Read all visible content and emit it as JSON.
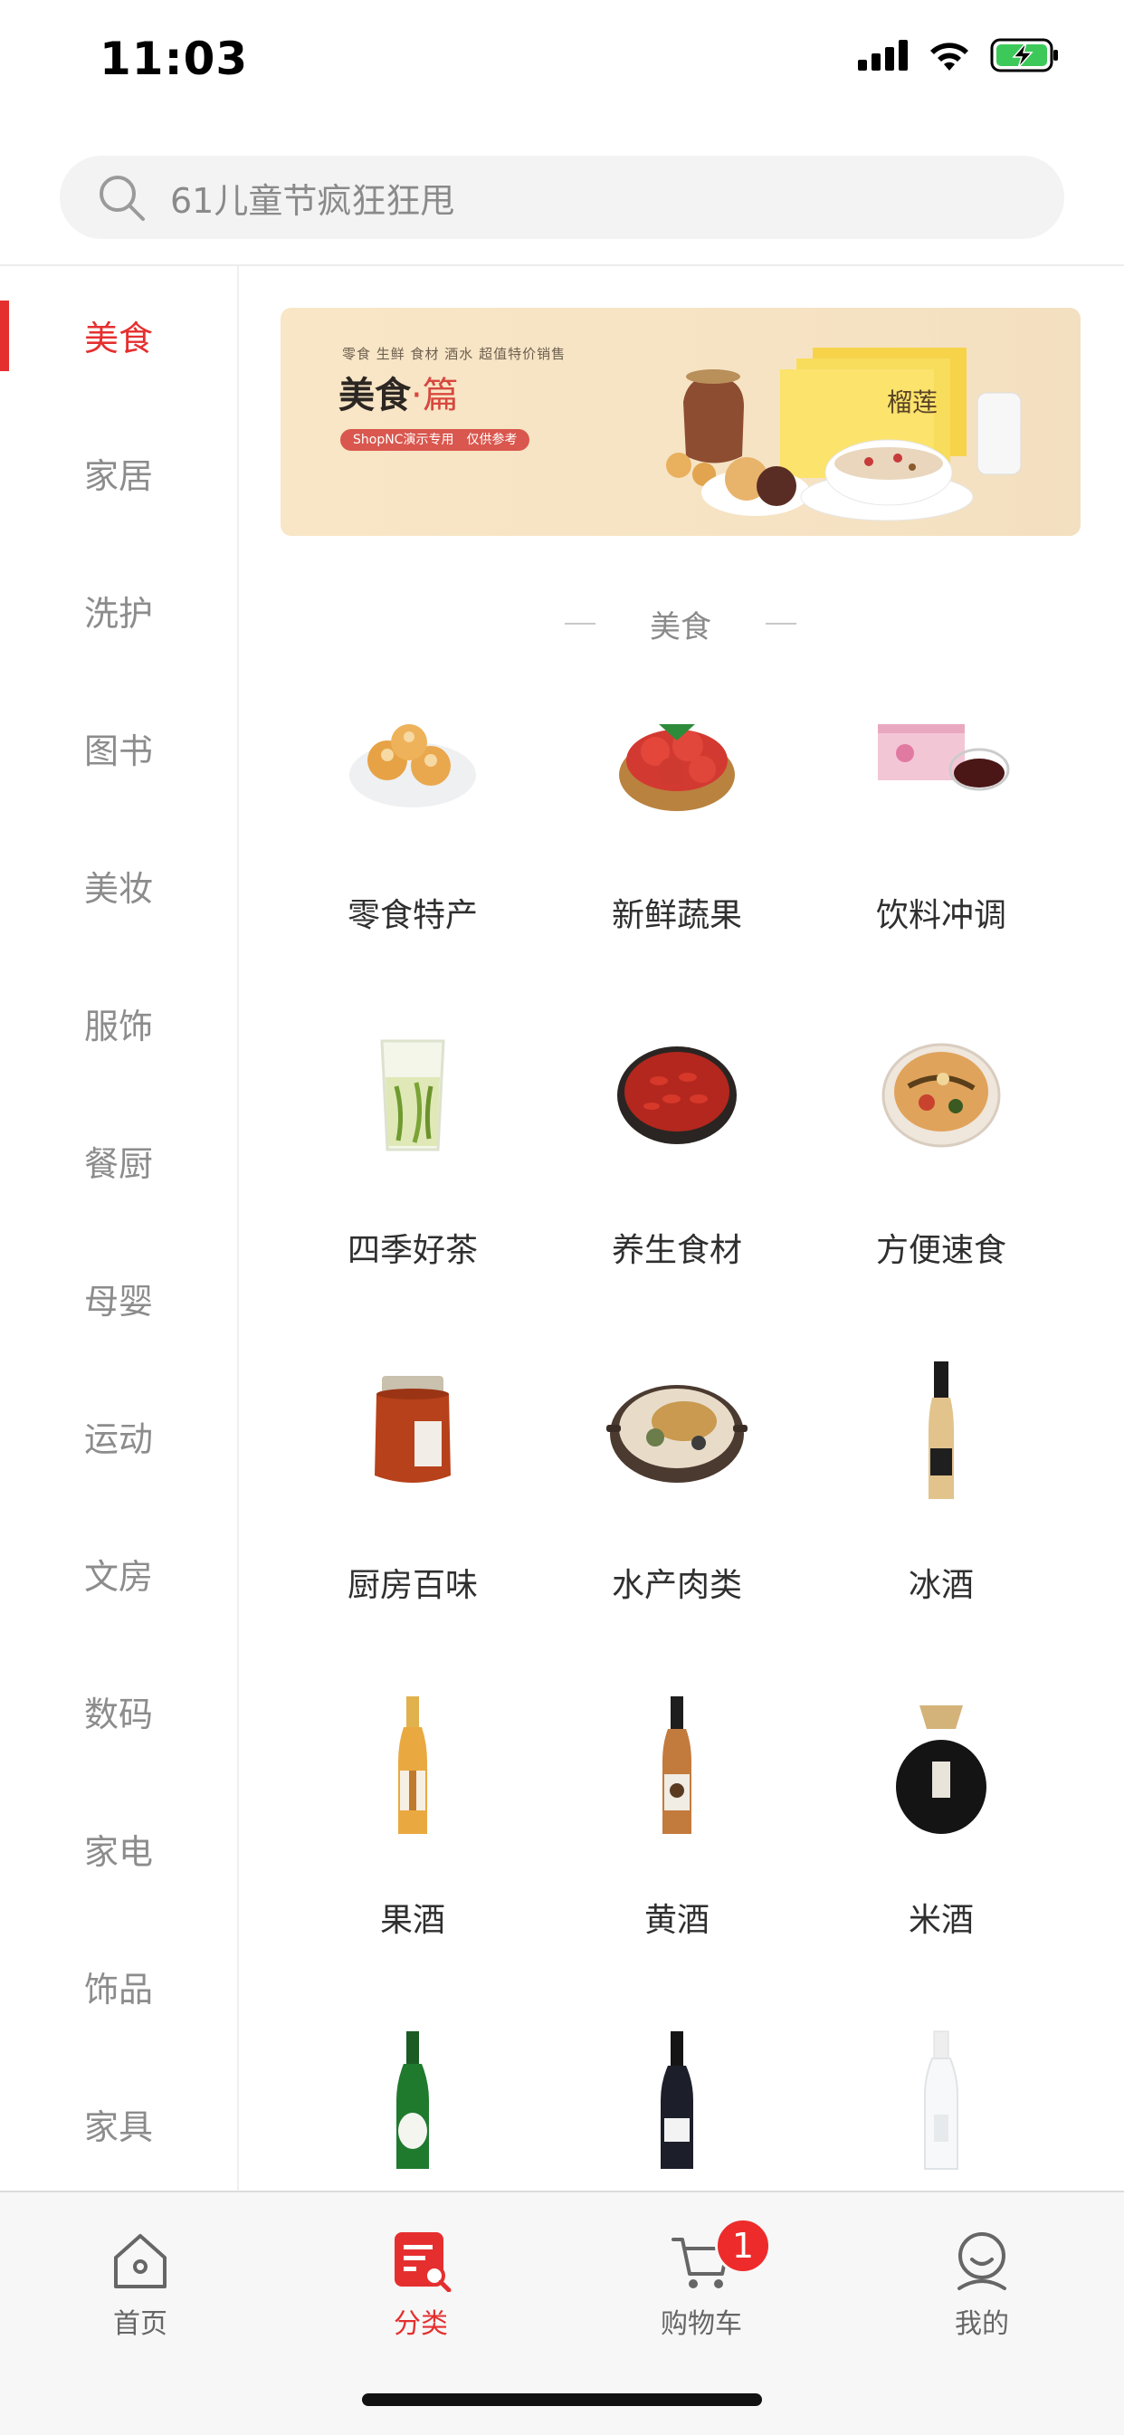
{
  "status_bar": {
    "time": "11:03"
  },
  "search": {
    "placeholder": "61儿童节疯狂狂甩"
  },
  "sidebar": {
    "active_index": 0,
    "items": [
      "美食",
      "家居",
      "洗护",
      "图书",
      "美妆",
      "服饰",
      "餐厨",
      "母婴",
      "运动",
      "文房",
      "数码",
      "家电",
      "饰品",
      "家具"
    ]
  },
  "banner": {
    "subtitle": "零食 生鲜 食材 酒水 超值特价销售",
    "title_main": "美食",
    "title_accent": "·篇",
    "tag": "ShopNC演示专用　仅供参考",
    "box_text": "榴莲"
  },
  "section": {
    "title": "美食"
  },
  "products": [
    {
      "label": "零食特产",
      "icon": "pastry-plate-icon"
    },
    {
      "label": "新鲜蔬果",
      "icon": "strawberry-basket-icon"
    },
    {
      "label": "饮料冲调",
      "icon": "tea-box-icon"
    },
    {
      "label": "四季好茶",
      "icon": "green-tea-glass-icon"
    },
    {
      "label": "养生食材",
      "icon": "goji-bowl-icon"
    },
    {
      "label": "方便速食",
      "icon": "noodle-bowl-icon"
    },
    {
      "label": "厨房百味",
      "icon": "sauce-jar-icon"
    },
    {
      "label": "水产肉类",
      "icon": "meat-pot-icon"
    },
    {
      "label": "冰酒",
      "icon": "ice-wine-bottle-icon"
    },
    {
      "label": "果酒",
      "icon": "fruit-wine-bottle-icon"
    },
    {
      "label": "黄酒",
      "icon": "yellow-wine-bottle-icon"
    },
    {
      "label": "米酒",
      "icon": "rice-wine-jar-icon"
    },
    {
      "label": "",
      "icon": "green-bottle-icon"
    },
    {
      "label": "",
      "icon": "red-wine-bottle-icon"
    },
    {
      "label": "",
      "icon": "clear-bottle-icon"
    }
  ],
  "tabbar": {
    "items": [
      {
        "label": "首页",
        "icon": "home-icon"
      },
      {
        "label": "分类",
        "icon": "category-icon",
        "active": true
      },
      {
        "label": "购物车",
        "icon": "cart-icon",
        "badge": "1"
      },
      {
        "label": "我的",
        "icon": "profile-icon"
      }
    ]
  },
  "colors": {
    "accent": "#e52f2f",
    "inactive_text": "#8c8c8c",
    "tabbar_bg": "#f7f7f7"
  }
}
